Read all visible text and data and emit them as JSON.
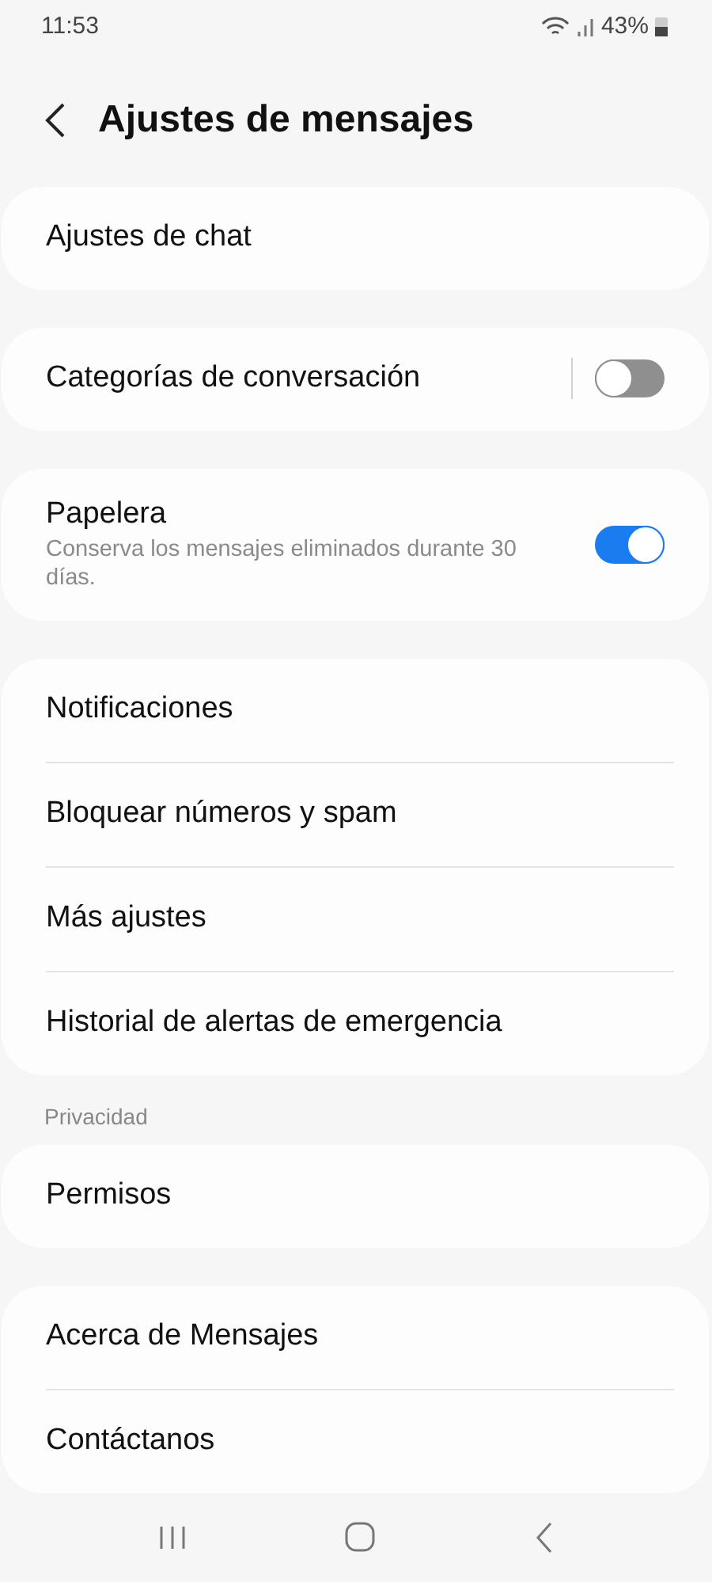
{
  "status_bar": {
    "time": "11:53",
    "battery": "43%"
  },
  "header": {
    "title": "Ajustes de mensajes"
  },
  "groups": [
    {
      "items": [
        {
          "kind": "link",
          "label": "Ajustes de chat"
        }
      ]
    },
    {
      "items": [
        {
          "kind": "toggle",
          "label": "Categorías de conversación",
          "on": false,
          "divider": true
        }
      ]
    },
    {
      "items": [
        {
          "kind": "toggle",
          "label": "Papelera",
          "subtitle": "Conserva los mensajes eliminados durante 30 días.",
          "on": true,
          "divider": false
        }
      ]
    },
    {
      "items": [
        {
          "kind": "link",
          "label": "Notificaciones"
        },
        {
          "kind": "link",
          "label": "Bloquear números y spam"
        },
        {
          "kind": "link",
          "label": "Más ajustes"
        },
        {
          "kind": "link",
          "label": "Historial de alertas de emergencia"
        }
      ]
    },
    {
      "heading": "Privacidad",
      "items": [
        {
          "kind": "link",
          "label": "Permisos"
        }
      ]
    },
    {
      "items": [
        {
          "kind": "link",
          "label": "Acerca de Mensajes"
        },
        {
          "kind": "link",
          "label": "Contáctanos"
        }
      ]
    }
  ]
}
